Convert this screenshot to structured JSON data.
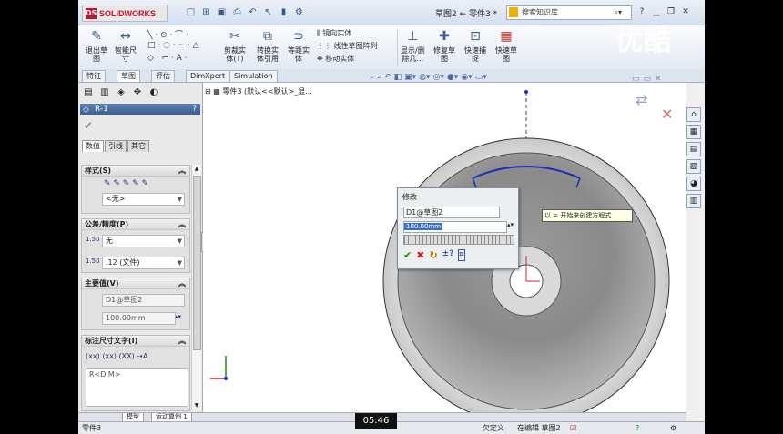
{
  "app": {
    "logo_text": "SOLIDWORKS",
    "document_title": "草图2 ← 零件3 *",
    "search_placeholder": "搜索知识库",
    "quick_access_icons": [
      "new-icon",
      "open-icon",
      "save-icon",
      "print-icon",
      "undo-icon",
      "select-icon",
      "rebuild-icon",
      "options-icon"
    ],
    "help_label": "?",
    "window_buttons": [
      "minimize-icon",
      "restore-icon",
      "close-icon"
    ]
  },
  "ribbon": {
    "buttons": [
      {
        "name": "exit-sketch",
        "label1": "退出草",
        "label2": "图"
      },
      {
        "name": "smart-dimension",
        "label1": "智能尺",
        "label2": "寸"
      },
      {
        "name": "trim-entities",
        "label1": "剪裁实",
        "label2": "体(T)"
      },
      {
        "name": "convert-entities",
        "label1": "转换实",
        "label2": "体引用"
      },
      {
        "name": "offset-entities",
        "label1": "等距实",
        "label2": "体"
      },
      {
        "name": "show-hide-relations",
        "label1": "显示/删",
        "label2": "除几..."
      },
      {
        "name": "repair-sketch",
        "label1": "修复草",
        "label2": "图"
      },
      {
        "name": "quick-snaps",
        "label1": "快速捕",
        "label2": "捉"
      },
      {
        "name": "instant-sketch",
        "label1": "快速草",
        "label2": "图"
      }
    ],
    "small_items": [
      "镜向实体",
      "线性草图阵列",
      "移动实体"
    ]
  },
  "tabs": [
    {
      "label": "特征",
      "active": false
    },
    {
      "label": "草图",
      "active": true
    },
    {
      "label": "评估",
      "active": false
    },
    {
      "label": "DimXpert",
      "active": false
    },
    {
      "label": "Simulation",
      "active": false
    }
  ],
  "property_manager": {
    "title": "R-1",
    "help": "?",
    "ok_symbol": "✔",
    "subtabs": [
      {
        "label": "数值",
        "active": true
      },
      {
        "label": "引线",
        "active": false
      },
      {
        "label": "其它",
        "active": false
      }
    ],
    "style": {
      "header": "样式(S)",
      "select": "<无>"
    },
    "tolerance": {
      "header": "公差/精度(P)",
      "tol_label": "无",
      "precision_label": ".12 (文件)"
    },
    "primary_value": {
      "header": "主要值(V)",
      "name": "D1@草图2",
      "value": "100.00mm"
    },
    "dim_text": {
      "header": "标注尺寸文字(I)",
      "text": "R<DIM>"
    }
  },
  "viewport": {
    "breadcrumb": "零件3 (默认<<默认>_显..."
  },
  "modify_dialog": {
    "title": "修改",
    "dim_name": "D1@草图2",
    "value": "100.00mm",
    "buttons": [
      "✔",
      "✖",
      "↻",
      "±?",
      "⌗"
    ]
  },
  "tooltip": "以 = 开始来创建方程式",
  "bottom_tabs": [
    "模型",
    "运动算例 1"
  ],
  "status": {
    "part": "零件3",
    "under_defined": "欠定义",
    "editing": "在编辑 草图2"
  },
  "video_time": "05:46",
  "watermark": "优酷",
  "colors": {
    "accent": "#3d5f91",
    "sketch_blue": "#1a2fb8"
  }
}
